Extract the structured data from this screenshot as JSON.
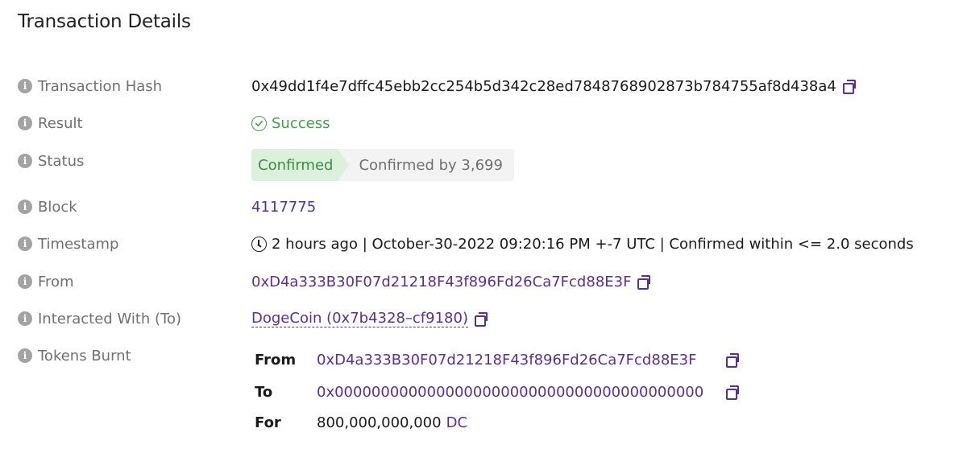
{
  "page": {
    "title": "Transaction Details"
  },
  "fields": {
    "hash": {
      "label": "Transaction Hash",
      "value": "0x49dd1f4e7dffc45ebb2cc254b5d342c28ed7848768902873b784755af8d438a4"
    },
    "result": {
      "label": "Result",
      "value": "Success"
    },
    "status": {
      "label": "Status",
      "badge": "Confirmed",
      "confirmations": "Confirmed by 3,699"
    },
    "block": {
      "label": "Block",
      "value": "4117775"
    },
    "timestamp": {
      "label": "Timestamp",
      "value": "2 hours ago | October-30-2022 09:20:16 PM +-7 UTC | Confirmed within <= 2.0 seconds"
    },
    "from": {
      "label": "From",
      "value": "0xD4a333B30F07d21218F43f896Fd26Ca7Fcd88E3F"
    },
    "to": {
      "label": "Interacted With (To)",
      "value": "DogeCoin (0x7b4328–cf9180)"
    },
    "tokens_burnt": {
      "label": "Tokens Burnt",
      "from_key": "From",
      "from_value": "0xD4a333B30F07d21218F43f896Fd26Ca7Fcd88E3F",
      "to_key": "To",
      "to_value": "0x0000000000000000000000000000000000000000",
      "for_key": "For",
      "amount": "800,000,000,000",
      "token": "DC"
    }
  },
  "colors": {
    "link": "#5b2d99",
    "success": "#3fa24a",
    "label": "#707070"
  },
  "icons": {
    "info": "info-icon",
    "copy": "copy-icon",
    "check": "check-circle-icon",
    "clock": "clock-icon"
  }
}
